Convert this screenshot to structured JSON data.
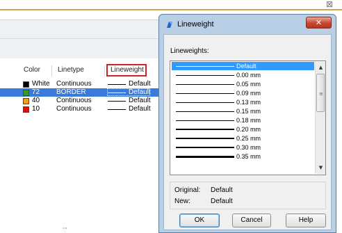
{
  "background": {
    "outer_close_glyph": "⊠",
    "grid": {
      "headers": [
        "Color",
        "Linetype",
        "Lineweight"
      ],
      "rows": [
        {
          "color_name": "White",
          "swatch": "#000000",
          "linetype": "Continuous",
          "lineweight": "Default",
          "selected": false
        },
        {
          "color_name": "72",
          "swatch": "#3c9a1a",
          "linetype": "BORDER",
          "lineweight": "Default",
          "selected": true
        },
        {
          "color_name": "40",
          "swatch": "#f0a020",
          "linetype": "Continuous",
          "lineweight": "Default",
          "selected": false
        },
        {
          "color_name": "10",
          "swatch": "#e01010",
          "linetype": "Continuous",
          "lineweight": "Default",
          "selected": false
        }
      ]
    },
    "scroll_hint": "'''"
  },
  "dialog": {
    "title": "Lineweight",
    "close_glyph": "✕",
    "lineweights_label": "Lineweights:",
    "items": [
      {
        "label": "Default",
        "selected": true
      },
      {
        "label": "0.00 mm",
        "selected": false
      },
      {
        "label": "0.05 mm",
        "selected": false
      },
      {
        "label": "0.09 mm",
        "selected": false
      },
      {
        "label": "0.13 mm",
        "selected": false
      },
      {
        "label": "0.15 mm",
        "selected": false
      },
      {
        "label": "0.18 mm",
        "selected": false
      },
      {
        "label": "0.20 mm",
        "selected": false
      },
      {
        "label": "0.25 mm",
        "selected": false
      },
      {
        "label": "0.30 mm",
        "selected": false
      },
      {
        "label": "0.35 mm",
        "selected": false
      }
    ],
    "original_label": "Original:",
    "original_value": "Default",
    "new_label": "New:",
    "new_value": "Default",
    "ok_label": "OK",
    "cancel_label": "Cancel",
    "help_label": "Help"
  },
  "colors": {
    "selection_blue": "#3399ff",
    "grid_selection": "#3a7ad8",
    "highlight_box": "#d32020",
    "dialog_frame": "#b9cfe6",
    "close_button": "#c9462f"
  },
  "icons": {
    "dialog_icon": "app-logo-icon",
    "scroll_up": "chevron-up-icon",
    "scroll_down": "chevron-down-icon"
  }
}
